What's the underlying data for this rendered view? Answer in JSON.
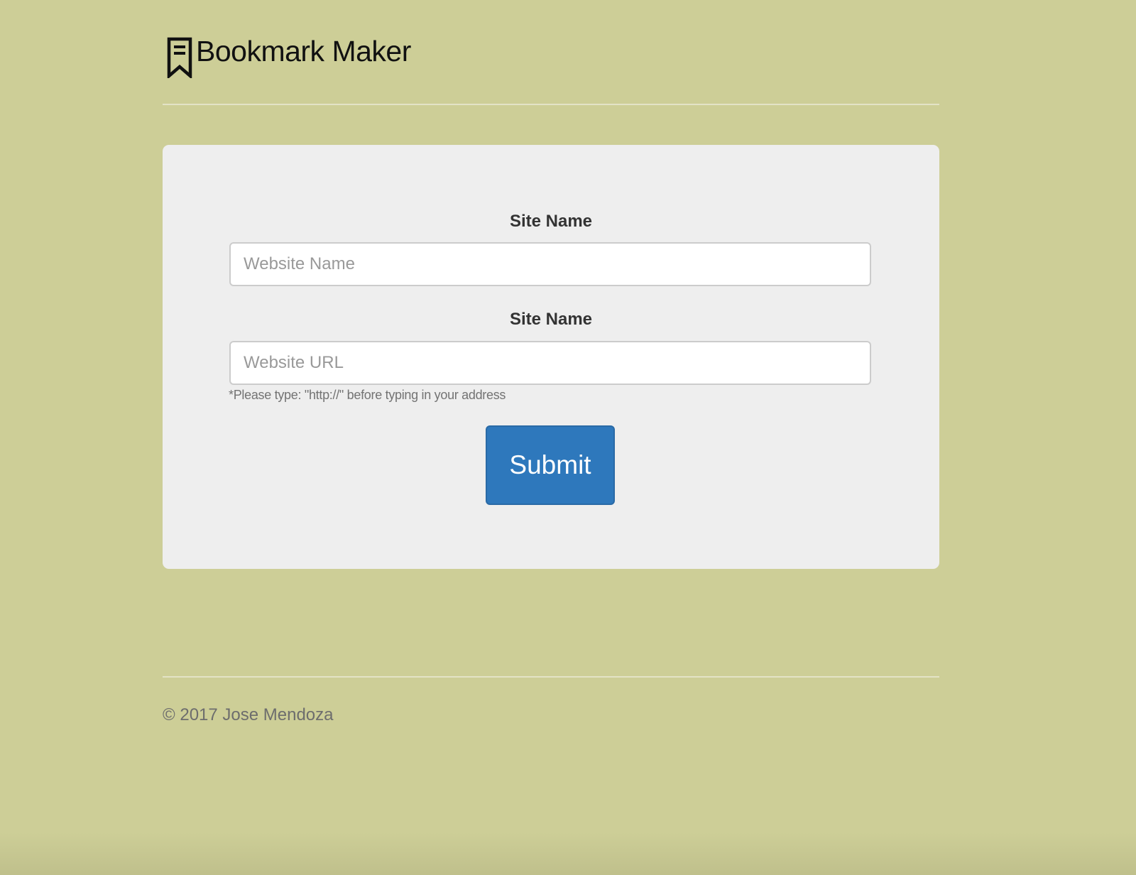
{
  "header": {
    "title": "Bookmark Maker",
    "icon": "bookmark-icon"
  },
  "form": {
    "name_field": {
      "label": "Site Name",
      "placeholder": "Website Name",
      "value": ""
    },
    "url_field": {
      "label": "Site Name",
      "placeholder": "Website URL",
      "value": ""
    },
    "hint": "*Please type: \"http://\" before typing in your address",
    "submit_label": "Submit"
  },
  "footer": {
    "copyright": "© 2017 Jose Mendoza"
  },
  "colors": {
    "background": "#cdce97",
    "card": "#eeeeee",
    "accent": "#2e78bc"
  }
}
